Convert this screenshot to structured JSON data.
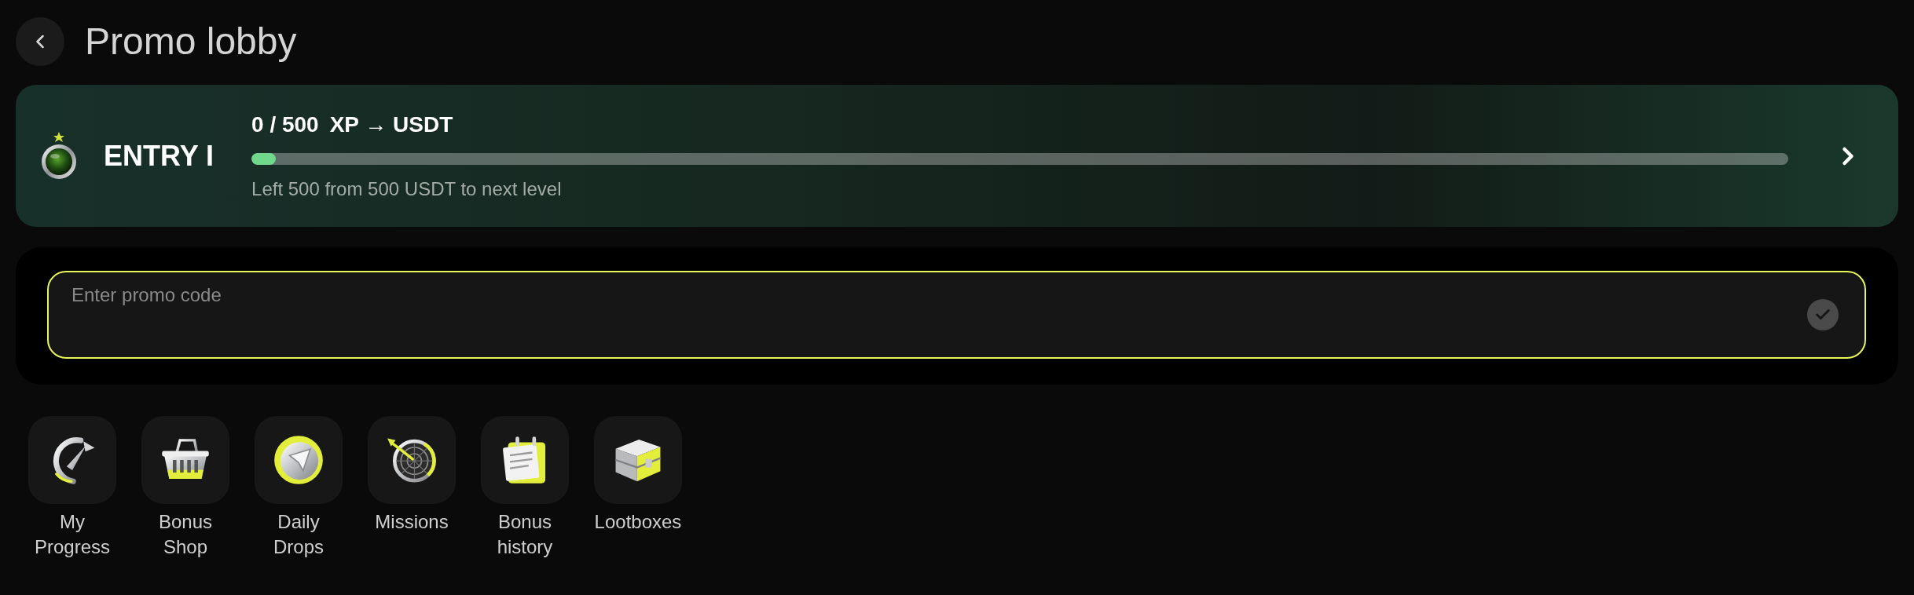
{
  "header": {
    "title": "Promo lobby"
  },
  "level_card": {
    "level_name": "ENTRY I",
    "progress_value": "0 / 500",
    "progress_unit": "XP → USDT",
    "level": 0.016,
    "remaining_text": "Left 500 from 500 USDT to next level"
  },
  "promo": {
    "placeholder": "Enter promo code"
  },
  "shortcuts": [
    {
      "label": "My Progress",
      "kind": "gauge"
    },
    {
      "label": "Bonus Shop",
      "kind": "basket"
    },
    {
      "label": "Daily Drops",
      "kind": "coin"
    },
    {
      "label": "Missions",
      "kind": "dartboard"
    },
    {
      "label": "Bonus history",
      "kind": "notepad"
    },
    {
      "label": "Lootboxes",
      "kind": "chest"
    }
  ]
}
